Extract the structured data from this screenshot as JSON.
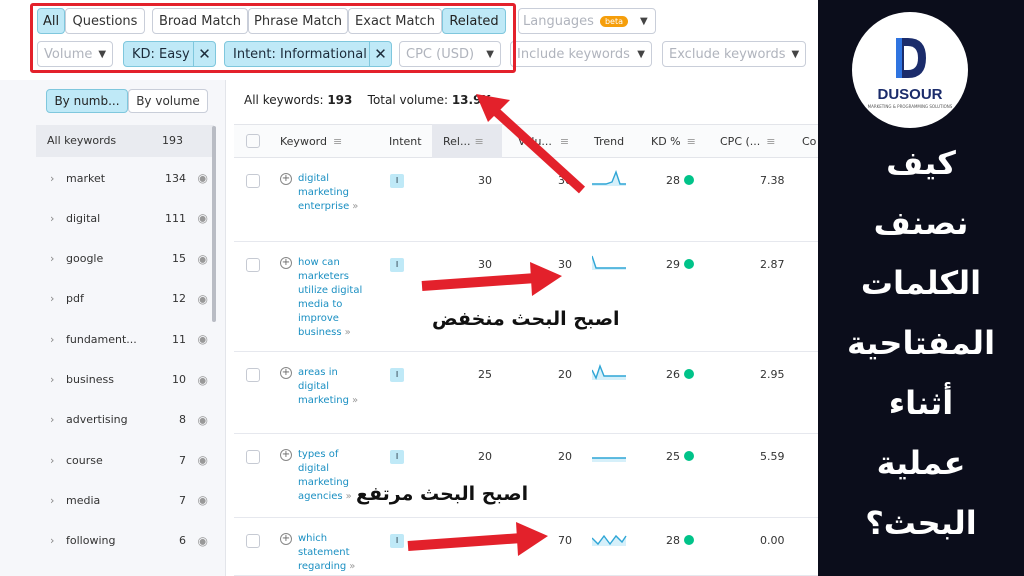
{
  "filters": {
    "tabs": [
      "All",
      "Questions"
    ],
    "match": [
      "Broad Match",
      "Phrase Match",
      "Exact Match",
      "Related"
    ],
    "languages": "Languages",
    "beta": "beta",
    "volume": "Volume",
    "kd_tag": "KD: Easy",
    "intent_tag": "Intent: Informational",
    "cpc": "CPC (USD)",
    "include": "Include keywords",
    "exclude": "Exclude keywords"
  },
  "sidebar": {
    "by_number": "By numb...",
    "by_volume": "By volume",
    "all_label": "All keywords",
    "all_count": "193",
    "items": [
      {
        "label": "market",
        "count": "134"
      },
      {
        "label": "digital",
        "count": "111"
      },
      {
        "label": "google",
        "count": "15"
      },
      {
        "label": "pdf",
        "count": "12"
      },
      {
        "label": "fundament...",
        "count": "11"
      },
      {
        "label": "business",
        "count": "10"
      },
      {
        "label": "advertising",
        "count": "8"
      },
      {
        "label": "course",
        "count": "7"
      },
      {
        "label": "media",
        "count": "7"
      },
      {
        "label": "following",
        "count": "6"
      }
    ]
  },
  "summary": {
    "all_keywords_label": "All keywords:",
    "all_keywords_value": "193",
    "total_volume_label": "Total volume:",
    "total_volume_value": "13.9K"
  },
  "table": {
    "headers": [
      "Keyword",
      "Intent",
      "Rel...",
      "Volu...",
      "Trend",
      "KD %",
      "CPC (...",
      "Co"
    ],
    "rows": [
      {
        "keyword": "digital marketing enterprise",
        "intent": "I",
        "rel": "30",
        "volume": "30",
        "kd": "28",
        "cpc": "7.38"
      },
      {
        "keyword": "how can marketers utilize digital media to improve business",
        "intent": "I",
        "rel": "30",
        "volume": "30",
        "kd": "29",
        "cpc": "2.87"
      },
      {
        "keyword": "areas in digital marketing",
        "intent": "I",
        "rel": "25",
        "volume": "20",
        "kd": "26",
        "cpc": "2.95"
      },
      {
        "keyword": "types of digital marketing agencies",
        "intent": "I",
        "rel": "20",
        "volume": "20",
        "kd": "25",
        "cpc": "5.59"
      },
      {
        "keyword": "which statement regarding",
        "intent": "I",
        "rel": "",
        "volume": "70",
        "kd": "28",
        "cpc": "0.00"
      }
    ]
  },
  "annotations": {
    "low": "اصبح البحث منخفض",
    "high": "اصبح البحث مرتفع"
  },
  "brand": {
    "logo_letter": "D",
    "name": "DUSOUR",
    "tagline": "MARKETING & PROGRAMMING SOLUTIONS",
    "title_lines": [
      "كيف",
      "نصنف",
      "الكلمات",
      "المفتاحية",
      "أثناء",
      "عملية",
      "البحث؟"
    ]
  },
  "colors": {
    "accent": "#bfe9f7",
    "annotation": "#e3212b",
    "kd_dot": "#00c389",
    "link": "#1a8fc2"
  }
}
